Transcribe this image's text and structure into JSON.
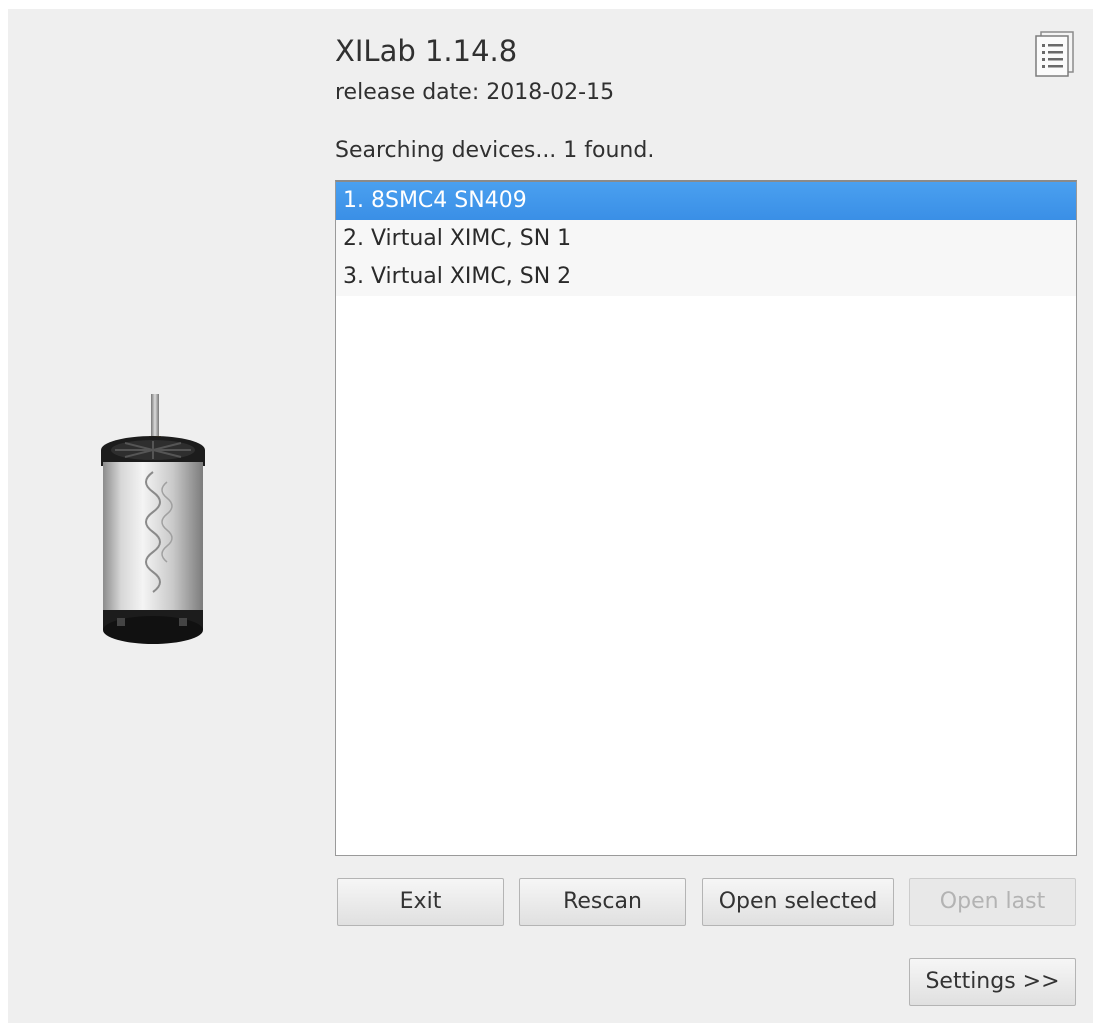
{
  "app": {
    "title": "XILab 1.14.8",
    "release": "release date: 2018-02-15",
    "status": "Searching devices... 1 found."
  },
  "devices": [
    {
      "label": "1. 8SMC4 SN409",
      "selected": true
    },
    {
      "label": "2. Virtual XIMC, SN 1",
      "selected": false
    },
    {
      "label": "3. Virtual XIMC, SN 2",
      "selected": false
    }
  ],
  "buttons": {
    "exit": "Exit",
    "rescan": "Rescan",
    "open_selected": "Open selected",
    "open_last": "Open last",
    "settings": "Settings >>"
  },
  "icons": {
    "notes": "document-list-icon",
    "motor": "stepper-motor-image"
  },
  "colors": {
    "selection": "#3a8fe6",
    "window_bg": "#efefef"
  }
}
